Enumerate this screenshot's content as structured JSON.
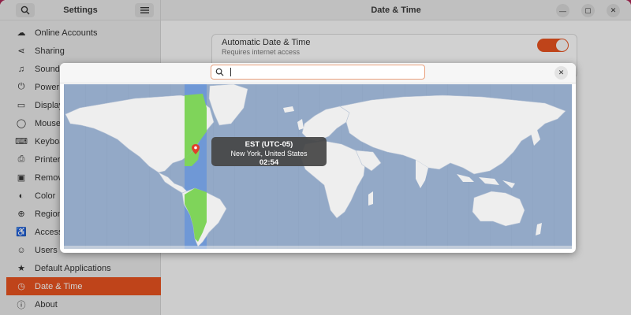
{
  "sidebar": {
    "title": "Settings",
    "items": [
      {
        "label": "Online Accounts",
        "icon": "cloud-icon",
        "glyph": "☁"
      },
      {
        "label": "Sharing",
        "icon": "share-icon",
        "glyph": "⋖"
      },
      {
        "label": "Sound",
        "icon": "music-note-icon",
        "glyph": "♫"
      },
      {
        "label": "Power",
        "icon": "power-icon",
        "glyph": "⏻"
      },
      {
        "label": "Displays",
        "icon": "display-icon",
        "glyph": "▭"
      },
      {
        "label": "Mouse",
        "icon": "mouse-icon",
        "glyph": "◯"
      },
      {
        "label": "Keyboard",
        "icon": "keyboard-icon",
        "glyph": "⌨"
      },
      {
        "label": "Printers",
        "icon": "printer-icon",
        "glyph": "⎙"
      },
      {
        "label": "Removable Media",
        "icon": "removable-media-icon",
        "glyph": "▣"
      },
      {
        "label": "Color",
        "icon": "color-icon",
        "glyph": "◐"
      },
      {
        "label": "Region",
        "icon": "globe-icon",
        "glyph": "⊕"
      },
      {
        "label": "Accessibility",
        "icon": "accessibility-icon",
        "glyph": "♿"
      },
      {
        "label": "Users",
        "icon": "users-icon",
        "glyph": "☺"
      },
      {
        "label": "Default Applications",
        "icon": "star-icon",
        "glyph": "★"
      },
      {
        "label": "Date & Time",
        "icon": "clock-icon",
        "glyph": "◷"
      },
      {
        "label": "About",
        "icon": "info-icon",
        "glyph": "ⓘ"
      }
    ],
    "active_index": 14
  },
  "header": {
    "title": "Date & Time"
  },
  "automatic_date_time": {
    "title": "Automatic Date & Time",
    "subtitle": "Requires internet access",
    "enabled": true
  },
  "timezone_dialog": {
    "search_value": "",
    "selected": {
      "zone": "EST (UTC-05)",
      "city": "New York, United States",
      "time": "02:54"
    }
  },
  "colors": {
    "accent": "#e95420",
    "ocean": "#93a9c7",
    "land": "#eeeeee",
    "highlight_zone": "#6f98d6",
    "highlight_land": "#7fd45a"
  }
}
